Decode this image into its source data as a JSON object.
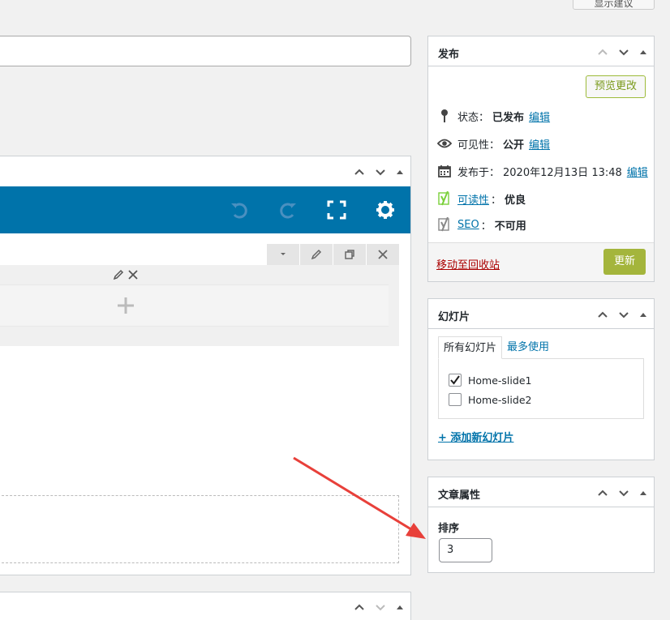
{
  "top_button": {
    "label": "显示建议"
  },
  "publish": {
    "title": "发布",
    "preview_label": "预览更改",
    "status_label": "状态：",
    "status_value": "已发布",
    "status_edit": "编辑",
    "visibility_label": "可见性：",
    "visibility_value": "公开",
    "visibility_edit": "编辑",
    "published_label": "发布于：",
    "published_value": "2020年12月13日 13:48",
    "published_edit": "编辑",
    "readability_link": "可读性",
    "readability_value": "优良",
    "seo_link": "SEO",
    "seo_value": "不可用",
    "trash_label": "移动至回收站",
    "update_label": "更新"
  },
  "slides": {
    "title": "幻灯片",
    "tab_all": "所有幻灯片",
    "tab_most_used": "最多使用",
    "items": [
      {
        "label": "Home-slide1",
        "checked": true
      },
      {
        "label": "Home-slide2",
        "checked": false
      }
    ],
    "add_new": "+ 添加新幻灯片"
  },
  "page_attributes": {
    "title": "文章属性",
    "order_label": "排序",
    "order_value": "3"
  },
  "colors": {
    "toolbar": "#0073aa",
    "update_button": "#a4b53c",
    "trash_link": "#aa0000",
    "link": "#0073aa",
    "annotation_arrow": "#e8403a"
  }
}
